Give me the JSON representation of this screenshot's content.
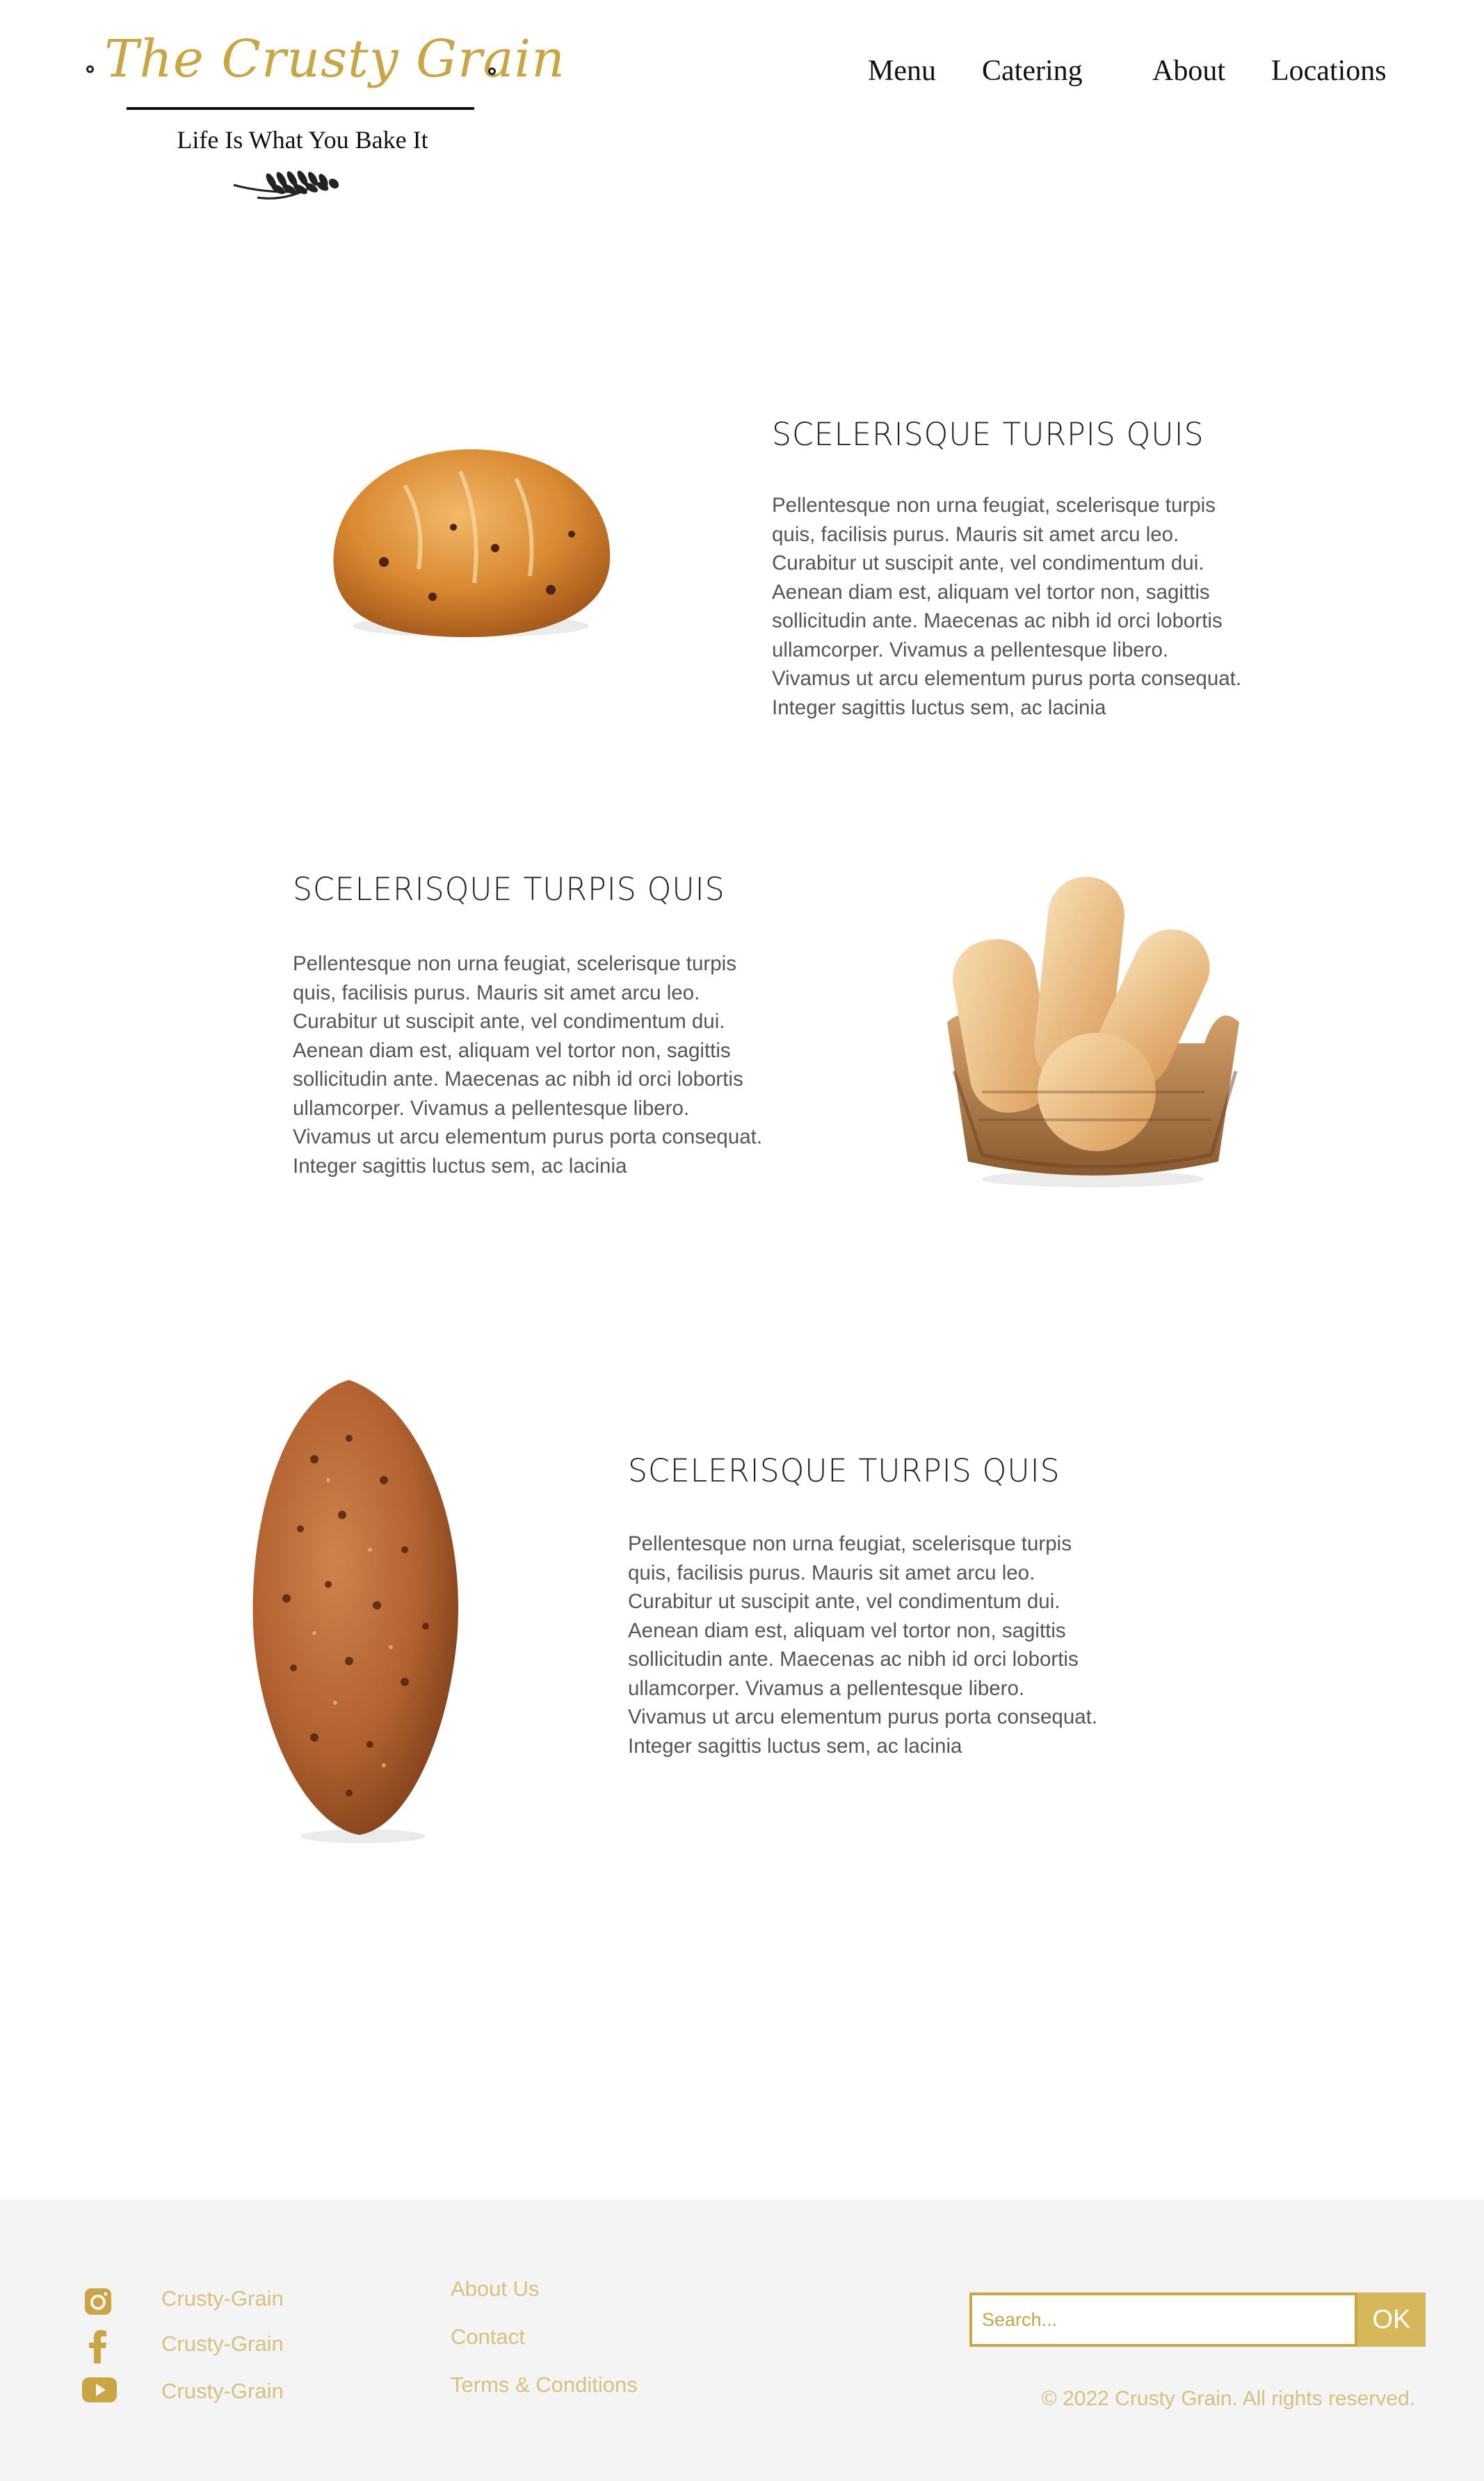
{
  "header": {
    "logo_title": "The Crusty Grain",
    "tagline": "Life Is What You Bake It",
    "nav": [
      {
        "label": "Menu"
      },
      {
        "label": "Catering"
      },
      {
        "label": "About"
      },
      {
        "label": "Locations"
      }
    ]
  },
  "sections": [
    {
      "heading": "SCELERISQUE TURPIS QUIS",
      "body": "Pellentesque non urna feugiat, scelerisque turpis quis, facilisis purus. Mauris sit amet arcu leo. Curabitur ut suscipit ante, vel condimentum dui. Aenean diam est, aliquam vel tortor non, sagittis sollicitudin ante. Maecenas ac nibh id orci lobortis ullamcorper. Vivamus a pellentesque libero. Vivamus ut arcu elementum purus porta consequat. Integer sagittis luctus sem, ac lacinia"
    },
    {
      "heading": "SCELERISQUE TURPIS QUIS",
      "body": "Pellentesque non urna feugiat, scelerisque turpis quis, facilisis purus. Mauris sit amet arcu leo. Curabitur ut suscipit ante, vel condimentum dui. Aenean diam est, aliquam vel tortor non, sagittis sollicitudin ante. Maecenas ac nibh id orci lobortis ullamcorper. Vivamus a pellentesque libero. Vivamus ut arcu elementum purus porta consequat. Integer sagittis luctus sem, ac lacinia"
    },
    {
      "heading": "SCELERISQUE TURPIS QUIS",
      "body": "Pellentesque non urna feugiat, scelerisque turpis quis, facilisis purus. Mauris sit amet arcu leo. Curabitur ut suscipit ante, vel condimentum dui. Aenean diam est, aliquam vel tortor non, sagittis sollicitudin ante. Maecenas ac nibh id orci lobortis ullamcorper. Vivamus a pellentesque libero. Vivamus ut arcu elementum purus porta consequat. Integer sagittis luctus sem, ac lacinia"
    }
  ],
  "footer": {
    "social": [
      {
        "icon": "instagram-icon",
        "label": "Crusty-Grain"
      },
      {
        "icon": "facebook-icon",
        "label": "Crusty-Grain"
      },
      {
        "icon": "youtube-icon",
        "label": "Crusty-Grain"
      }
    ],
    "links": [
      {
        "label": "About Us"
      },
      {
        "label": "Contact"
      },
      {
        "label": "Terms & Conditions"
      }
    ],
    "search": {
      "placeholder": "Search...",
      "button_label": "OK"
    },
    "copyright": "© 2022 Crusty Grain. All rights reserved."
  },
  "colors": {
    "brand_gold": "#c9a643",
    "footer_text": "#d6c17e",
    "footer_bg": "#f4f4f4"
  }
}
